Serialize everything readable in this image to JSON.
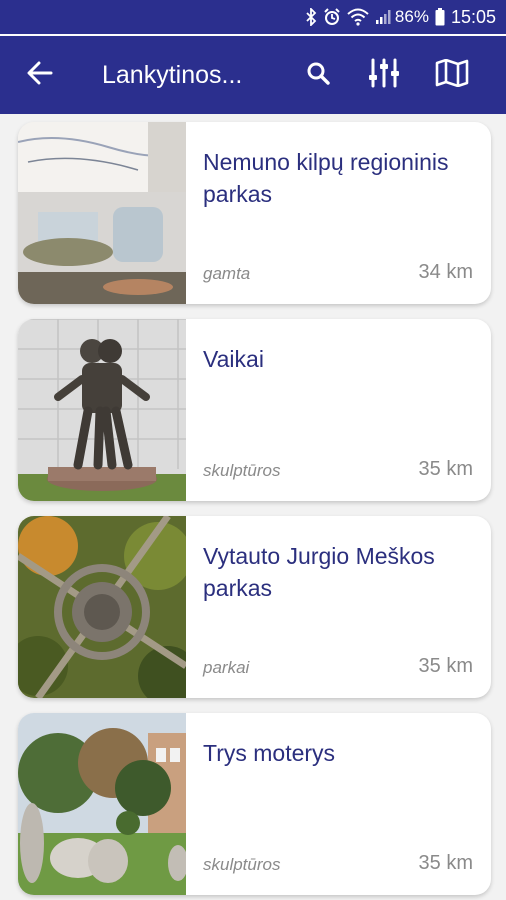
{
  "status": {
    "battery": "86%",
    "time": "15:05",
    "icons": [
      "bluetooth-icon",
      "alarm-icon",
      "wifi-icon",
      "signal-icon",
      "battery-icon"
    ]
  },
  "appbar": {
    "title": "Lankytinos...",
    "icons": [
      "back-arrow-icon",
      "search-icon",
      "filter-sliders-icon",
      "map-icon"
    ]
  },
  "colors": {
    "primary": "#2b2f8e",
    "title_text": "#2b2f7e",
    "muted": "#8a8a8a"
  },
  "places": [
    {
      "name": "Nemuno kilpų regioninis parkas",
      "category": "gamta",
      "distance": "34 km"
    },
    {
      "name": "Vaikai",
      "category": "skulptūros",
      "distance": "35 km"
    },
    {
      "name": "Vytauto Jurgio Meškos parkas",
      "category": "parkai",
      "distance": "35 km"
    },
    {
      "name": "Trys moterys",
      "category": "skulptūros",
      "distance": "35 km"
    }
  ]
}
